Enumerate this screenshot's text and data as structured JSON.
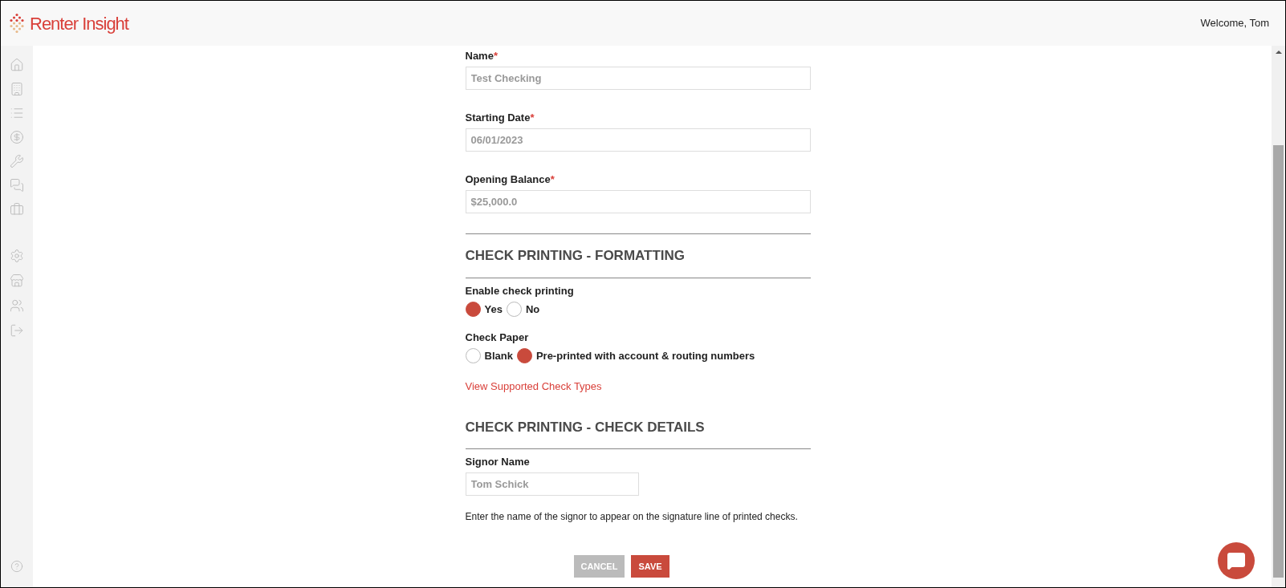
{
  "header": {
    "logo": "Renter Insight",
    "welcome": "Welcome, Tom"
  },
  "fields": [
    {
      "label": "Name",
      "required_mark": "*",
      "value": "Test Checking"
    },
    {
      "label": "Starting Date",
      "required_mark": "*",
      "value": "06/01/2023"
    },
    {
      "label": "Opening Balance",
      "required_mark": "*",
      "value": "$25,000.0"
    }
  ],
  "formatting": {
    "heading": "CHECK PRINTING - FORMATTING",
    "groups": [
      {
        "label": "Enable check printing",
        "options": [
          {
            "label": "Yes",
            "selected": true
          },
          {
            "label": "No",
            "selected": false
          }
        ]
      },
      {
        "label": "Check Paper",
        "options": [
          {
            "label": "Blank",
            "selected": false
          },
          {
            "label": "Pre-printed with account & routing numbers",
            "selected": true
          }
        ]
      }
    ],
    "link": "View Supported Check Types"
  },
  "details": {
    "heading": "CHECK PRINTING - CHECK DETAILS",
    "label": "Signor Name",
    "value": "Tom Schick",
    "help": "Enter the name of the signor to appear on the signature line of printed checks."
  },
  "buttons": {
    "cancel": "CANCEL",
    "save": "SAVE"
  }
}
